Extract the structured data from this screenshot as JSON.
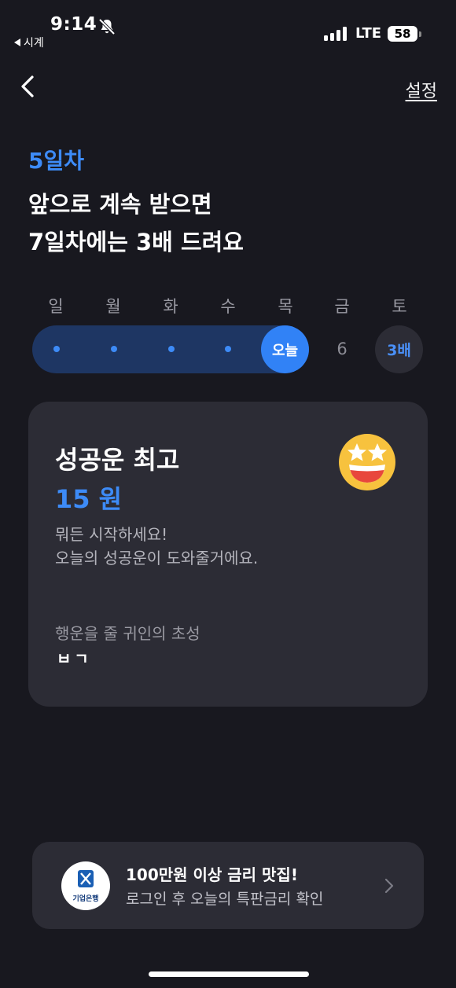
{
  "status_bar": {
    "time": "9:14",
    "back_app": "시계",
    "network": "LTE",
    "battery": "58"
  },
  "nav": {
    "settings_label": "설정"
  },
  "header": {
    "day_label": "5일차",
    "headline_line1": "앞으로 계속 받으면",
    "headline_line2": "7일차에는 3배 드려요"
  },
  "week": {
    "days": [
      "일",
      "월",
      "화",
      "수",
      "목",
      "금",
      "토"
    ],
    "completed_days": 4,
    "today_label": "오늘",
    "day6_label": "6",
    "day7_label": "3배",
    "accent_color": "#3182f6"
  },
  "card": {
    "title": "성공운 최고",
    "amount": "15 원",
    "desc_line1": "뭐든 시작하세요!",
    "desc_line2": "오늘의 성공운이 도와줄거에요.",
    "hint_label": "행운을 줄 귀인의 초성",
    "hint_value": "ㅂㄱ",
    "emoji_icon": "star-struck-emoji-icon"
  },
  "banner": {
    "logo_text": "기업은행",
    "title": "100만원 이상 금리 맛집!",
    "subtitle": "로그인 후 오늘의 특판금리 확인"
  }
}
